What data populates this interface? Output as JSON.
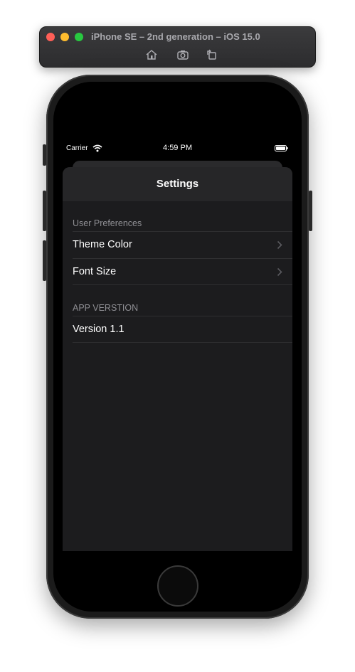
{
  "simulator": {
    "title": "iPhone SE – 2nd generation – iOS 15.0",
    "toolbar": [
      "home-icon",
      "screenshot-icon",
      "rotate-icon"
    ]
  },
  "status_bar": {
    "carrier": "Carrier",
    "time": "4:59 PM"
  },
  "nav": {
    "title": "Settings"
  },
  "sections": [
    {
      "header": "User Preferences",
      "rows": [
        {
          "label": "Theme Color",
          "chevron": true
        },
        {
          "label": "Font Size",
          "chevron": true
        }
      ]
    },
    {
      "header": "APP VERSTION",
      "rows": [
        {
          "label": "Version 1.1",
          "chevron": false
        }
      ]
    }
  ],
  "colors": {
    "background": "#1c1c1e",
    "nav_background": "#262628",
    "secondary_text": "#8e8e93"
  }
}
